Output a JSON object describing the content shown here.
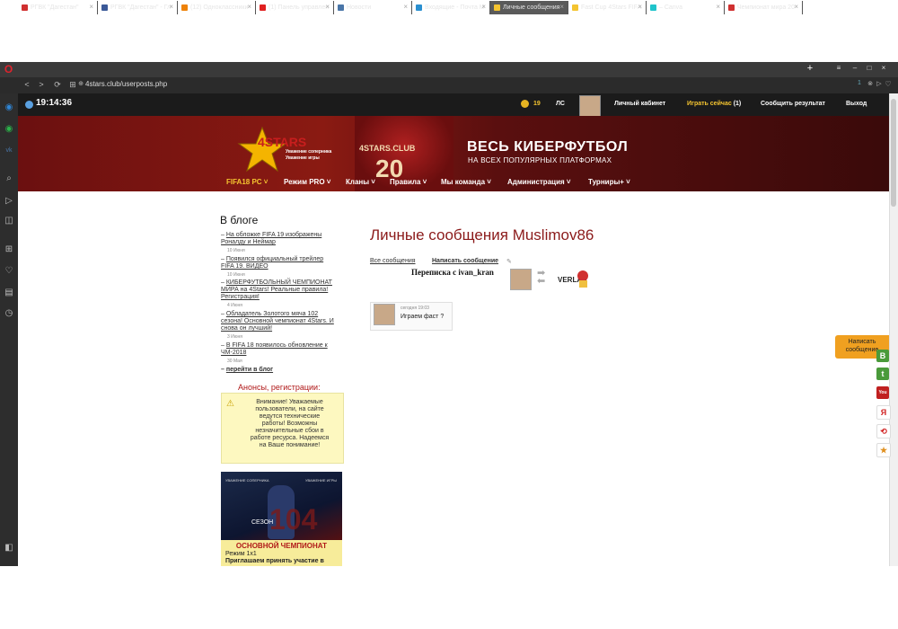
{
  "browser": {
    "tabs": [
      {
        "label": "РГВК \"Дагестан\"",
        "color": "#d03030"
      },
      {
        "label": "РГВК \"Дагестан\" - Гл",
        "color": "#3b5998"
      },
      {
        "label": "(12) Одноклассники",
        "color": "#ee8208"
      },
      {
        "label": "(1) Панель управлен",
        "color": "#e02020"
      },
      {
        "label": "Новости",
        "color": "#4a76a8"
      },
      {
        "label": "Входящие - Почта М",
        "color": "#2a8fd0"
      },
      {
        "label": "Личные сообщения",
        "color": "#f4c430"
      },
      {
        "label": "Fast Cup 4Stars FIFA",
        "color": "#f4c430"
      },
      {
        "label": "– Canva",
        "color": "#20c4cb"
      },
      {
        "label": "Чемпионат мира 20",
        "color": "#d03030"
      }
    ],
    "url": "4stars.club/userposts.php",
    "tab_badge": "1"
  },
  "site": {
    "clock": "19:14:36",
    "coins": "19",
    "ls": "ЛС",
    "top_links": {
      "cabinet": "Личный кабинет",
      "play_now": "Играть сейчас",
      "play_now_count": "(1)",
      "report": "Сообщить результат",
      "logout": "Выход"
    },
    "banner": {
      "logo_text": "4STARS",
      "logo_sub1": "Уважение соперника",
      "logo_sub2": "Уважение игры",
      "jersey_text": "4STARS.CLUB",
      "jersey_num": "20",
      "title": "ВЕСЬ КИБЕРФУТБОЛ",
      "subtitle": "НА ВСЕХ ПОПУЛЯРНЫХ ПЛАТФОРМАХ"
    },
    "menu": [
      {
        "label": "FIFA18 PC"
      },
      {
        "label": "Режим PRO"
      },
      {
        "label": "Кланы"
      },
      {
        "label": "Правила"
      },
      {
        "label": "Мы команда"
      },
      {
        "label": "Администрация"
      },
      {
        "label": "Турниры+"
      }
    ]
  },
  "blog": {
    "title": "В блоге",
    "posts": [
      {
        "title": "На обложке FIFA 19 изображены Роналду и Неймар",
        "date": "10 Июня"
      },
      {
        "title": "Появился официальный трейлер FIFA 19. ВИДЕО",
        "date": "10 Июня"
      },
      {
        "title": "КИБЕРФУТБОЛЬНЫЙ ЧЕМПИОНАТ МИРА на 4Stars! Реальные правила! Регистрация!",
        "date": "4 Июня"
      },
      {
        "title": "Обладатель Золотого мяча 102 сезона! Основной чемпионат 4Stars. И снова он лучший!",
        "date": "3 Июня"
      },
      {
        "title": "В FIFA 18 появилось обновление к ЧМ-2018",
        "date": "30 Мая"
      }
    ],
    "goto": "перейти в блог",
    "announce_title": "Анонсы, регистрации:",
    "notice": "Внимание! Уважаемые пользователи, на сайте ведутся технические работы! Возможны незначительные сбои в работе ресурса. Надеемся на Ваше понимание!",
    "champ": {
      "top_left": "УВАЖЕНИЕ СОПЕРНИКА",
      "top_right": "УВАЖЕНИЕ ИГРЫ",
      "season_label": "СЕЗОН",
      "season_num": "104",
      "title": "ОСНОВНОЙ ЧЕМПИОНАТ",
      "mode": "Режим 1x1",
      "invite": "Приглашаем принять участие в"
    }
  },
  "messages": {
    "title": "Личные сообщения Muslimov86",
    "all_link": "Все сообщения",
    "write_link": "Написать сообщение",
    "conversation_label": "Переписка с ivan_kran",
    "message": {
      "time": "сегодня 19:03",
      "text": "Играем фаст ?"
    }
  },
  "side_widget": {
    "write_label": "Написать сообщение",
    "social": [
      {
        "name": "vk",
        "glyph": "В",
        "color": "#4a9a3a"
      },
      {
        "name": "twitter",
        "glyph": "t",
        "color": "#4a9a3a"
      },
      {
        "name": "youtube",
        "glyph": "You",
        "color": "#c02020"
      },
      {
        "name": "yandex",
        "glyph": "Я",
        "color": "#ffffff"
      },
      {
        "name": "share",
        "glyph": "⟲",
        "color": "#ffffff"
      },
      {
        "name": "star",
        "glyph": "★",
        "color": "#ffffff"
      }
    ]
  }
}
